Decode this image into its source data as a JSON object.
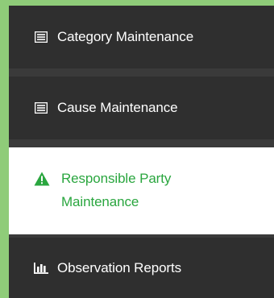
{
  "sidebar": {
    "items": [
      {
        "label": "Category Maintenance",
        "icon": "list-icon",
        "active": false
      },
      {
        "label": "Cause Maintenance",
        "icon": "list-icon",
        "active": false
      },
      {
        "label": "Responsible Party Maintenance",
        "icon": "warning-icon",
        "active": true
      },
      {
        "label": "Observation Reports",
        "icon": "bar-chart-icon",
        "active": false
      }
    ]
  },
  "colors": {
    "menu_background": "#2f2f2f",
    "active_background": "#ffffff",
    "active_text": "#2aa63f",
    "border_green": "#8fcc79"
  }
}
